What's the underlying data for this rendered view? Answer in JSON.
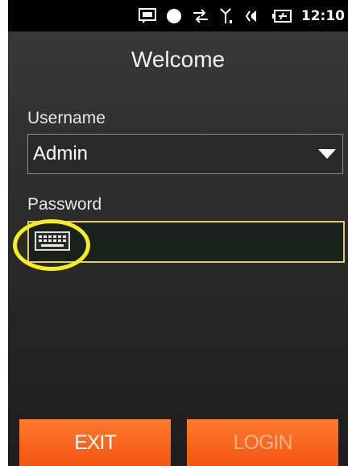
{
  "status_bar": {
    "time": "12:10",
    "icons": [
      "message-icon",
      "record-dot-icon",
      "sync-arrows-icon",
      "signal-icon",
      "volume-icon",
      "battery-icon"
    ]
  },
  "title": "Welcome",
  "username": {
    "label": "Username",
    "value": "Admin"
  },
  "password": {
    "label": "Password",
    "value": "",
    "keyboard_icon": "keyboard-icon"
  },
  "buttons": {
    "exit_label": "EXIT",
    "login_label": "LOGIN"
  },
  "colors": {
    "accent_orange": "#f25512",
    "focus_border": "#e9c85a",
    "highlight_circle": "#f5ef1c"
  }
}
